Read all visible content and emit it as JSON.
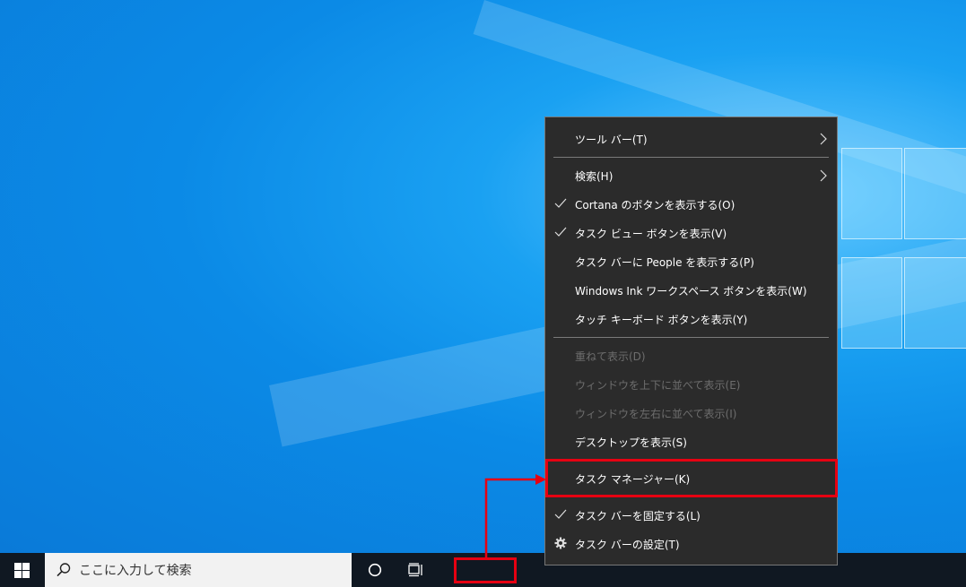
{
  "taskbar": {
    "search_placeholder": "ここに入力して検索"
  },
  "context_menu": {
    "items": [
      {
        "label": "ツール バー(T)",
        "checked": false,
        "submenu": true,
        "disabled": false
      },
      {
        "label": "検索(H)",
        "checked": false,
        "submenu": true,
        "disabled": false
      },
      {
        "label": "Cortana のボタンを表示する(O)",
        "checked": true,
        "submenu": false,
        "disabled": false
      },
      {
        "label": "タスク ビュー ボタンを表示(V)",
        "checked": true,
        "submenu": false,
        "disabled": false
      },
      {
        "label": "タスク バーに People を表示する(P)",
        "checked": false,
        "submenu": false,
        "disabled": false
      },
      {
        "label": "Windows Ink ワークスペース ボタンを表示(W)",
        "checked": false,
        "submenu": false,
        "disabled": false
      },
      {
        "label": "タッチ キーボード ボタンを表示(Y)",
        "checked": false,
        "submenu": false,
        "disabled": false
      },
      {
        "label": "重ねて表示(D)",
        "checked": false,
        "submenu": false,
        "disabled": true
      },
      {
        "label": "ウィンドウを上下に並べて表示(E)",
        "checked": false,
        "submenu": false,
        "disabled": true
      },
      {
        "label": "ウィンドウを左右に並べて表示(I)",
        "checked": false,
        "submenu": false,
        "disabled": true
      },
      {
        "label": "デスクトップを表示(S)",
        "checked": false,
        "submenu": false,
        "disabled": false
      },
      {
        "label": "タスク マネージャー(K)",
        "checked": false,
        "submenu": false,
        "disabled": false,
        "highlighted": true
      },
      {
        "label": "タスク バーを固定する(L)",
        "checked": true,
        "submenu": false,
        "disabled": false
      },
      {
        "label": "タスク バーの設定(T)",
        "checked": false,
        "submenu": false,
        "disabled": false,
        "icon": "gear-icon"
      }
    ]
  },
  "annotation": {
    "highlight_color": "#e60012"
  },
  "colors": {
    "menu_bg": "#2b2b2b",
    "taskbar_bg": "#101822",
    "desktop_accent": "#0b8ae6"
  }
}
